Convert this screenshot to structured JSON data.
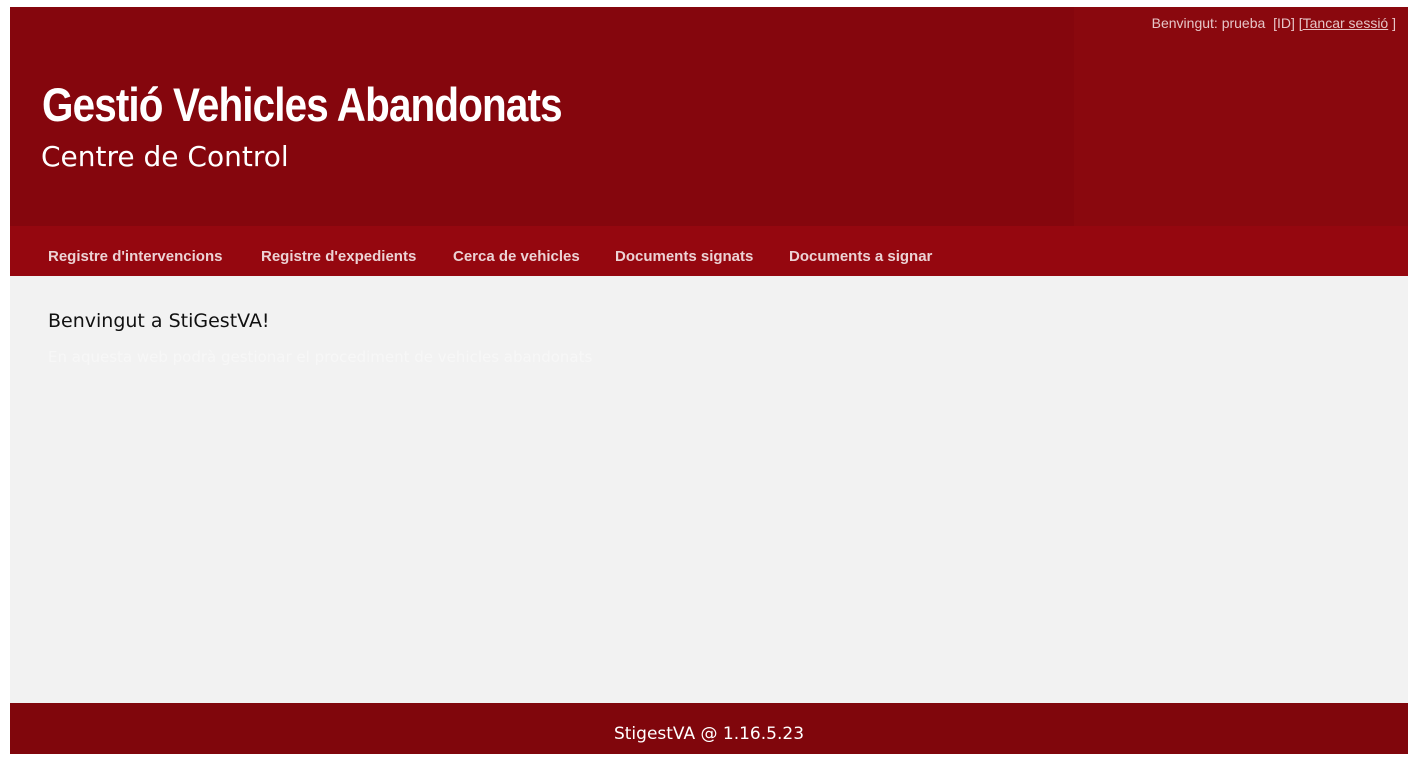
{
  "header": {
    "user_greeting": "Benvingut: prueba",
    "id_label": "[ID]",
    "logout_open": "[",
    "logout_label": "Tancar sessió",
    "logout_close": "]",
    "title": "Gestió Vehicles Abandonats",
    "subtitle": "Centre de Control"
  },
  "nav": {
    "items": [
      {
        "label": "Registre d'intervencions"
      },
      {
        "label": "Registre d'expedients"
      },
      {
        "label": "Cerca de vehicles"
      },
      {
        "label": "Documents signats"
      },
      {
        "label": "Documents a signar"
      }
    ]
  },
  "main": {
    "welcome_title": "Benvingut a StiGestVA!",
    "welcome_text": "En aquesta web podrà gestionar el procediment de vehicles abandonats"
  },
  "footer": {
    "text": "StigestVA @ 1.16.5.23"
  },
  "colors": {
    "header_bg": "#85060d",
    "nav_bg": "#95070f",
    "content_bg": "#f2f2f2",
    "footer_bg": "#80060c"
  }
}
